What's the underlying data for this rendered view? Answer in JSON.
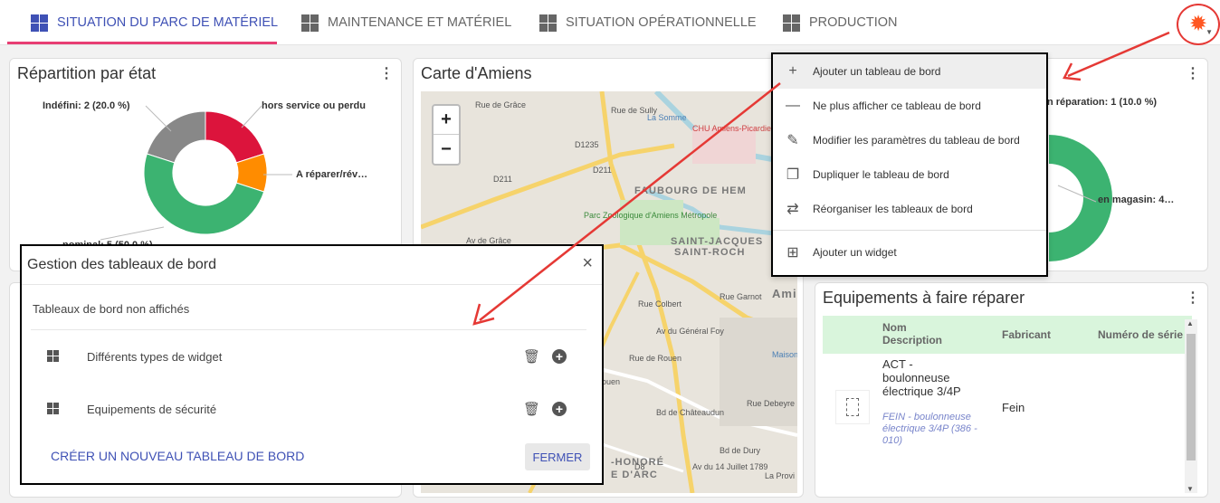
{
  "tabs": [
    {
      "label": "SITUATION DU PARC DE MATÉRIEL",
      "active": true
    },
    {
      "label": "MAINTENANCE ET MATÉRIEL",
      "active": false
    },
    {
      "label": "SITUATION OPÉRATIONNELLE",
      "active": false
    },
    {
      "label": "PRODUCTION",
      "active": false
    }
  ],
  "settings_icon": "gear-icon",
  "colors": {
    "accent": "#3f51b5",
    "tab_underline": "#e83e73",
    "gear": "#ff5722",
    "annotation": "#e53935",
    "table_header": "#d9f5dc"
  },
  "card_repartition": {
    "title": "Répartition par état",
    "labels": {
      "indefini": "Indéfini: 2 (20.0 %)",
      "hors_service": "hors service ou perdu",
      "a_reparer": "A réparer/rév…",
      "nominal": "nominal: 5 (50.0 %)"
    }
  },
  "card_map": {
    "title": "Carte d'Amiens",
    "zoom_in": "+",
    "zoom_out": "−",
    "places": [
      "FAUBOURG DE HEM",
      "SAINT-JACQUES",
      "SAINT-ROCH",
      "Parc Zoologique d'Amiens Métropole",
      "CHU Amiens-Picardie Centre hospitalier",
      "La Somme",
      "Av de Grâce",
      "Rue de Rouen",
      "Av du Général Foy",
      "Bd de Châteaudun",
      "Bd de Dury",
      "Rue Colbert",
      "Rue de Sully",
      "Rue de Grâce",
      "Maison de J",
      "La Provi",
      "Amie",
      "D1235",
      "D211",
      "D211",
      "-HONORÉ",
      "E D'ARC",
      "Av du 14 Juillet 1789",
      "Rue Debeyre",
      "Rue Garnot",
      "ouen",
      "D8"
    ]
  },
  "card_right_top": {
    "labels": {
      "en_reparation": "n réparation: 1 (10.0 %)",
      "en_magasin": "en magasin: 4…"
    }
  },
  "card_table": {
    "title": "Equipements à faire réparer",
    "columns": {
      "nom": "Nom",
      "description": "Description",
      "fabricant": "Fabricant",
      "serie": "Numéro de série"
    },
    "rows": [
      {
        "nom": "ACT - boulonneuse électrique 3/4P",
        "description": "FEIN - boulonneuse électrique 3/4P (386 - 010)",
        "fabricant": "Fein",
        "serie": ""
      }
    ]
  },
  "menu": {
    "items": [
      {
        "icon": "plus-icon",
        "label": "Ajouter un tableau de bord"
      },
      {
        "icon": "minus-icon",
        "label": "Ne plus afficher ce tableau de bord"
      },
      {
        "icon": "pencil-icon",
        "label": "Modifier les paramètres du tableau de bord"
      },
      {
        "icon": "copy-icon",
        "label": "Dupliquer le tableau de bord"
      },
      {
        "icon": "swap-icon",
        "label": "Réorganiser les tableaux de bord"
      },
      {
        "icon": "add-box-icon",
        "label": "Ajouter un widget"
      }
    ]
  },
  "dialog": {
    "title": "Gestion des tableaux de bord",
    "close": "×",
    "subtitle": "Tableaux de bord non affichés",
    "rows": [
      {
        "label": "Différents types de widget"
      },
      {
        "label": "Equipements de sécurité"
      }
    ],
    "create_label": "CRÉER UN NOUVEAU TABLEAU DE BORD",
    "close_button": "FERMER"
  },
  "chart_data": {
    "type": "pie",
    "categories": [
      "Indéfini",
      "hors service ou perdu",
      "A réparer/rév…",
      "nominal"
    ],
    "values": [
      2,
      2,
      1,
      5
    ],
    "colors": [
      "#888888",
      "#dc143c",
      "#ff8c00",
      "#3cb371"
    ],
    "title": "Répartition par état"
  }
}
